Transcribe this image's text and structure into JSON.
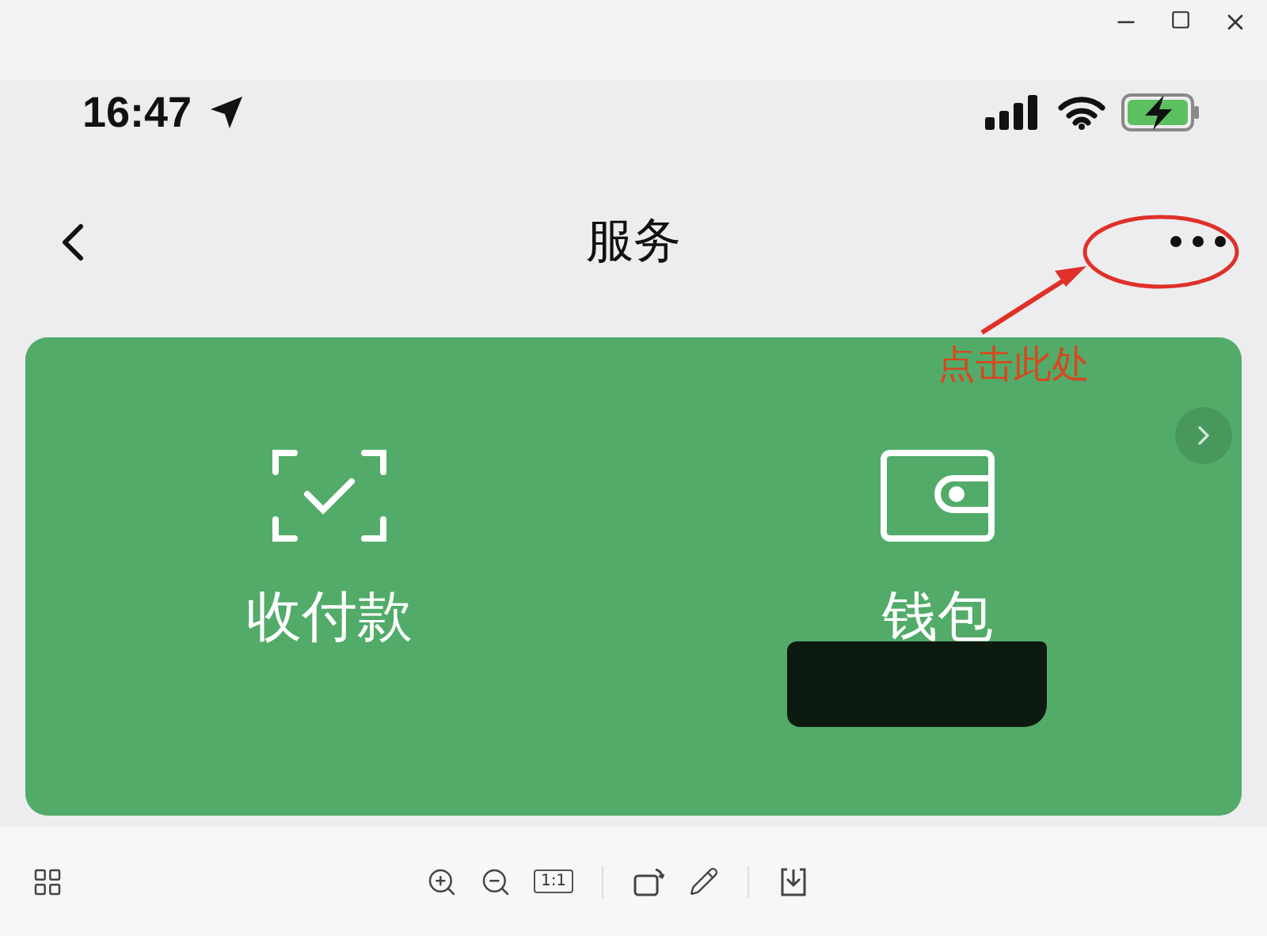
{
  "status_bar": {
    "time": "16:47"
  },
  "nav": {
    "title": "服务"
  },
  "annotation": {
    "label": "点击此处"
  },
  "card": {
    "actions": [
      {
        "label": "收付款",
        "kind": "scan",
        "redacted": false
      },
      {
        "label": "钱包",
        "kind": "wallet",
        "redacted": true
      }
    ]
  },
  "toolbar": {
    "actual_size": "1:1"
  }
}
